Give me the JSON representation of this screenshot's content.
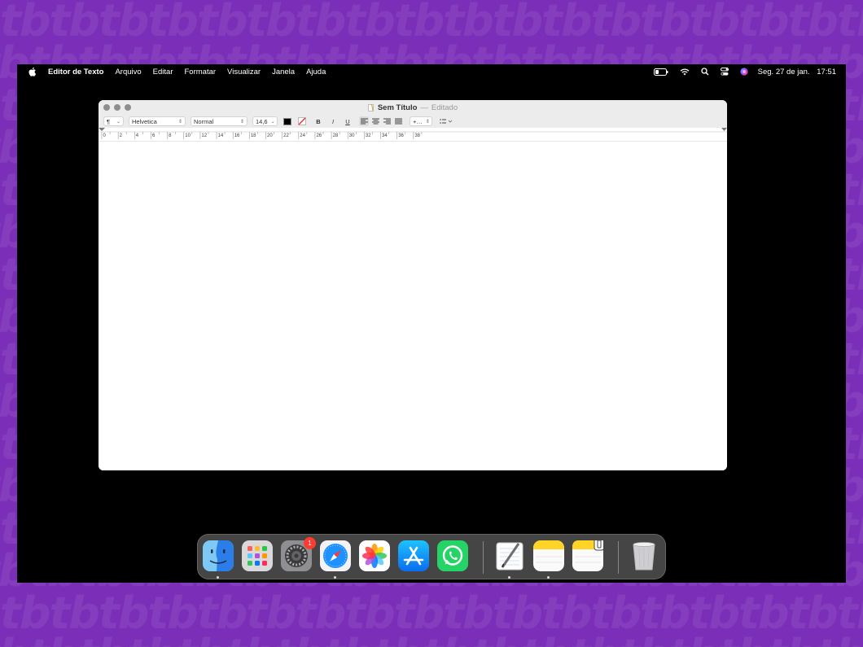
{
  "menubar": {
    "app_name": "Editor de Texto",
    "items": [
      "Arquivo",
      "Editar",
      "Formatar",
      "Visualizar",
      "Janela",
      "Ajuda"
    ],
    "clock_date": "Seg. 27 de jan.",
    "clock_time": "17:51",
    "status_icons": [
      "battery-icon",
      "wifi-icon",
      "search-icon",
      "control-center-icon",
      "siri-icon"
    ]
  },
  "window": {
    "title": "Sem Título",
    "separator": "—",
    "state": "Editado",
    "toolbar": {
      "paragraph_style": "¶",
      "font_family": "Helvetica",
      "font_style": "Normal",
      "font_size": "14,6",
      "bold": "B",
      "italic": "I",
      "underline": "U",
      "line_spacing": "+…",
      "text_color": "#000000"
    },
    "ruler_labels": [
      "0",
      "2",
      "4",
      "6",
      "8",
      "10",
      "12",
      "14",
      "16",
      "18",
      "20",
      "22",
      "24",
      "26",
      "28",
      "30",
      "32",
      "34",
      "36",
      "38"
    ]
  },
  "dock": {
    "apps": [
      "finder-icon",
      "launchpad-icon",
      "system-settings-icon",
      "safari-icon",
      "photos-icon",
      "app-store-icon",
      "whatsapp-icon",
      "textedit-icon",
      "notes-icon",
      "notes-shortcut-icon",
      "trash-icon"
    ],
    "settings_badge": "1"
  },
  "colors": {
    "background": "#7b2fb8",
    "screen": "#000000",
    "window_chrome": "#ececec",
    "badge": "#ff3b30"
  }
}
